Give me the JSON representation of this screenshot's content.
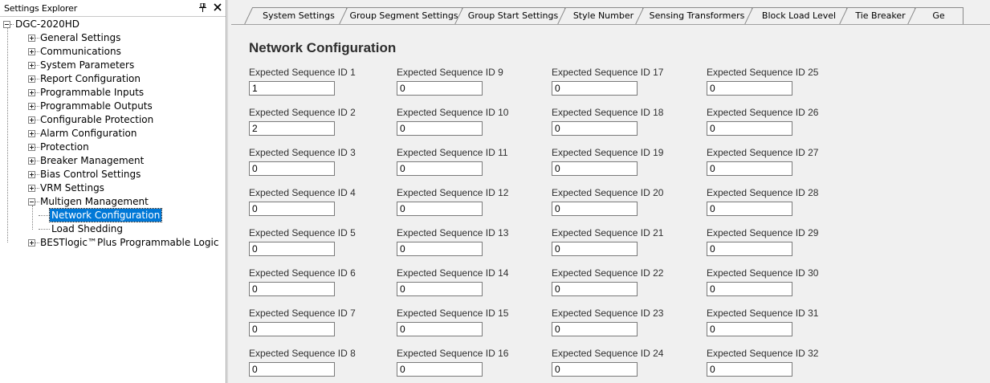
{
  "explorer": {
    "title": "Settings Explorer",
    "pin_glyph": "1",
    "close_glyph": "✕",
    "root": "DGC-2020HD",
    "items": [
      {
        "label": "General Settings",
        "expanded": false
      },
      {
        "label": "Communications",
        "expanded": false
      },
      {
        "label": "System Parameters",
        "expanded": false
      },
      {
        "label": "Report Configuration",
        "expanded": false
      },
      {
        "label": "Programmable Inputs",
        "expanded": false
      },
      {
        "label": "Programmable Outputs",
        "expanded": false
      },
      {
        "label": "Configurable Protection",
        "expanded": false
      },
      {
        "label": "Alarm Configuration",
        "expanded": false
      },
      {
        "label": "Protection",
        "expanded": false
      },
      {
        "label": "Breaker Management",
        "expanded": false
      },
      {
        "label": "Bias Control Settings",
        "expanded": false
      },
      {
        "label": "VRM Settings",
        "expanded": false
      },
      {
        "label": "Multigen Management",
        "expanded": true
      },
      {
        "label": "Network Configuration",
        "child": true,
        "selected": true
      },
      {
        "label": "Load Shedding",
        "child": true
      },
      {
        "label": "BESTlogic™Plus Programmable Logic",
        "expanded": false
      }
    ]
  },
  "tabs": [
    {
      "label": "System Settings"
    },
    {
      "label": "Group Segment Settings"
    },
    {
      "label": "Group Start Settings"
    },
    {
      "label": "Style Number"
    },
    {
      "label": "Sensing Transformers"
    },
    {
      "label": "Block Load Level"
    },
    {
      "label": "Tie Breaker"
    },
    {
      "label": "Ge"
    }
  ],
  "panel": {
    "title": "Network Configuration",
    "fields": [
      {
        "label": "Expected Sequence ID 1",
        "value": "1"
      },
      {
        "label": "Expected Sequence ID 2",
        "value": "2"
      },
      {
        "label": "Expected Sequence ID 3",
        "value": "0"
      },
      {
        "label": "Expected Sequence ID 4",
        "value": "0"
      },
      {
        "label": "Expected Sequence ID 5",
        "value": "0"
      },
      {
        "label": "Expected Sequence ID 6",
        "value": "0"
      },
      {
        "label": "Expected Sequence ID 7",
        "value": "0"
      },
      {
        "label": "Expected Sequence ID 8",
        "value": "0"
      },
      {
        "label": "Expected Sequence ID 9",
        "value": "0"
      },
      {
        "label": "Expected Sequence ID 10",
        "value": "0"
      },
      {
        "label": "Expected Sequence ID 11",
        "value": "0"
      },
      {
        "label": "Expected Sequence ID 12",
        "value": "0"
      },
      {
        "label": "Expected Sequence ID 13",
        "value": "0"
      },
      {
        "label": "Expected Sequence ID 14",
        "value": "0"
      },
      {
        "label": "Expected Sequence ID 15",
        "value": "0"
      },
      {
        "label": "Expected Sequence ID 16",
        "value": "0"
      },
      {
        "label": "Expected Sequence ID 17",
        "value": "0"
      },
      {
        "label": "Expected Sequence ID 18",
        "value": "0"
      },
      {
        "label": "Expected Sequence ID 19",
        "value": "0"
      },
      {
        "label": "Expected Sequence ID 20",
        "value": "0"
      },
      {
        "label": "Expected Sequence ID 21",
        "value": "0"
      },
      {
        "label": "Expected Sequence ID 22",
        "value": "0"
      },
      {
        "label": "Expected Sequence ID 23",
        "value": "0"
      },
      {
        "label": "Expected Sequence ID 24",
        "value": "0"
      },
      {
        "label": "Expected Sequence ID 25",
        "value": "0"
      },
      {
        "label": "Expected Sequence ID 26",
        "value": "0"
      },
      {
        "label": "Expected Sequence ID 27",
        "value": "0"
      },
      {
        "label": "Expected Sequence ID 28",
        "value": "0"
      },
      {
        "label": "Expected Sequence ID 29",
        "value": "0"
      },
      {
        "label": "Expected Sequence ID 30",
        "value": "0"
      },
      {
        "label": "Expected Sequence ID 31",
        "value": "0"
      },
      {
        "label": "Expected Sequence ID 32",
        "value": "0"
      }
    ]
  },
  "colors": {
    "selection": "#0078d7",
    "background": "#f0f0f0"
  }
}
